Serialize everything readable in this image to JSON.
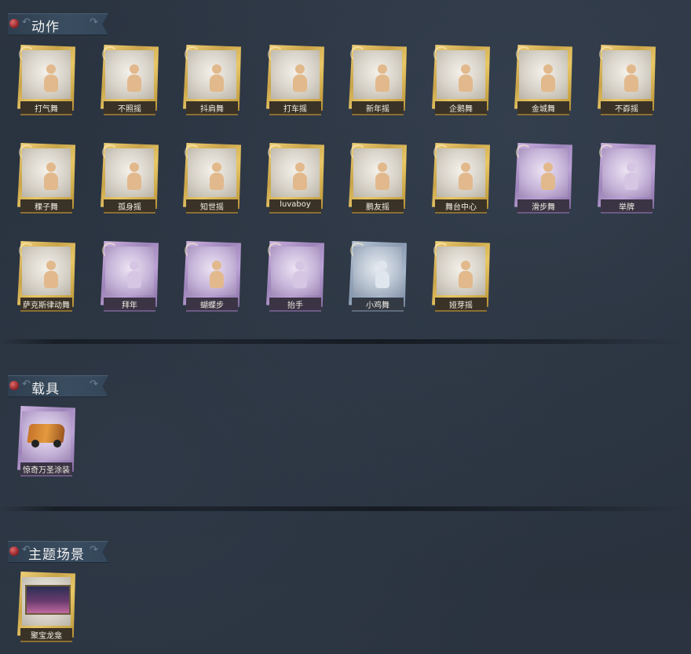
{
  "sections": [
    {
      "title": "动作",
      "cards": [
        {
          "label": "打气舞",
          "rarity": "gold"
        },
        {
          "label": "不照摇",
          "rarity": "gold"
        },
        {
          "label": "抖肩舞",
          "rarity": "gold"
        },
        {
          "label": "打车摇",
          "rarity": "gold"
        },
        {
          "label": "新年摇",
          "rarity": "gold"
        },
        {
          "label": "企鹅舞",
          "rarity": "gold"
        },
        {
          "label": "金城舞",
          "rarity": "gold"
        },
        {
          "label": "不孬摇",
          "rarity": "gold"
        },
        {
          "label": "稞子舞",
          "rarity": "gold"
        },
        {
          "label": "孤身摇",
          "rarity": "gold"
        },
        {
          "label": "知世摇",
          "rarity": "gold"
        },
        {
          "label": "luvaboy",
          "rarity": "gold"
        },
        {
          "label": "鹏友摇",
          "rarity": "gold"
        },
        {
          "label": "舞台中心",
          "rarity": "gold"
        },
        {
          "label": "滑步舞",
          "rarity": "purple"
        },
        {
          "label": "举牌",
          "rarity": "purple"
        },
        {
          "label": "萨克斯律动舞",
          "rarity": "gold"
        },
        {
          "label": "拜年",
          "rarity": "purple"
        },
        {
          "label": "蝴蝶步",
          "rarity": "purple"
        },
        {
          "label": "抬手",
          "rarity": "purple"
        },
        {
          "label": "小鸡舞",
          "rarity": "blue"
        },
        {
          "label": "娅芽摇",
          "rarity": "gold"
        }
      ]
    },
    {
      "title": "载具",
      "cards": [
        {
          "label": "惊奇万圣涂装",
          "rarity": "purple"
        }
      ]
    },
    {
      "title": "主题场景",
      "cards": [
        {
          "label": "聚宝龙龛",
          "rarity": "gold"
        }
      ]
    }
  ],
  "colors": {
    "background": "#2a3340",
    "gold": "#d9b457",
    "purple": "#a98fc4",
    "blue": "#93a3b8",
    "header_gem": "#b8343a"
  }
}
